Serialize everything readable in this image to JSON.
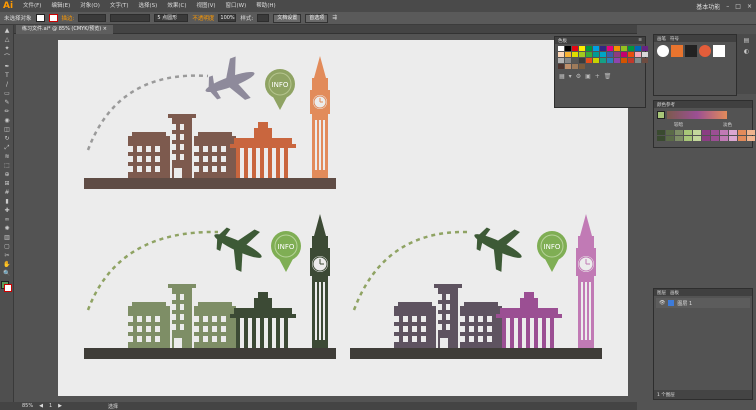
{
  "app": {
    "logo": "Ai"
  },
  "menu": [
    "文件(F)",
    "编辑(E)",
    "对象(O)",
    "文字(T)",
    "选择(S)",
    "效果(C)",
    "视图(V)",
    "窗口(W)",
    "帮助(H)"
  ],
  "top_right": {
    "workspace": "基本功能"
  },
  "control_bar": {
    "selection": "未选择对象",
    "stroke_label": "描边:",
    "opacity_label": "不透明度",
    "opacity_value": "100%",
    "style_label": "样式:",
    "doc_setup": "文档设置",
    "preferences": "首选项",
    "brush_value": "5 点圆形"
  },
  "document_tab": {
    "title": "练习文件.ai* @ 85% (CMYK/预览)"
  },
  "swatches_panel": {
    "title": "色板",
    "colors": [
      "#ffffff",
      "#000000",
      "#e30613",
      "#ffed00",
      "#009640",
      "#00a0e3",
      "#312783",
      "#e6007e",
      "#f39200",
      "#95c11f",
      "#00963f",
      "#0069b4",
      "#662483",
      "#fbd5b5",
      "#f9b233",
      "#dedc00",
      "#a1c91e",
      "#3aaa35",
      "#009a93",
      "#00a5c6",
      "#3e5ba9",
      "#8e3a80",
      "#c5006e",
      "#e84e0f",
      "#f4a7b9",
      "#d8d8d8",
      "#b2b2b2",
      "#878787",
      "#575756",
      "#3c3c3b",
      "#e94e1b",
      "#c6d300",
      "#16a085",
      "#2980b9",
      "#8e44ad",
      "#d35400",
      "#c0392b",
      "#7f8c8d",
      "#6d4c41",
      "#4e342e",
      "#bf8f6b",
      "#9e7b5b",
      "#7a5c3e"
    ]
  },
  "brush_panel": {
    "tabs": [
      "画笔",
      "符号"
    ]
  },
  "color_guide": {
    "title": "颜色参考",
    "left_label": "较暗",
    "right_label": "淡色"
  },
  "layers_panel": {
    "tabs": [
      "图层",
      "画板"
    ],
    "layer_name": "图层 1",
    "footer": "1 个图层"
  },
  "statusbar": {
    "zoom": "85%",
    "page": "1",
    "tool": "选择"
  },
  "artwork": {
    "bubble_label": "INFO"
  },
  "tools": [
    "select-tool",
    "direct-select-tool",
    "magic-wand-tool",
    "lasso-tool",
    "pen-tool",
    "type-tool",
    "line-tool",
    "rectangle-tool",
    "paintbrush-tool",
    "pencil-tool",
    "blob-brush-tool",
    "eraser-tool",
    "rotate-tool",
    "scale-tool",
    "width-tool",
    "free-transform-tool",
    "shape-builder-tool",
    "perspective-grid-tool",
    "mesh-tool",
    "gradient-tool",
    "eyedropper-tool",
    "blend-tool",
    "symbol-sprayer-tool",
    "column-graph-tool",
    "artboard-tool",
    "slice-tool",
    "hand-tool",
    "zoom-tool"
  ]
}
